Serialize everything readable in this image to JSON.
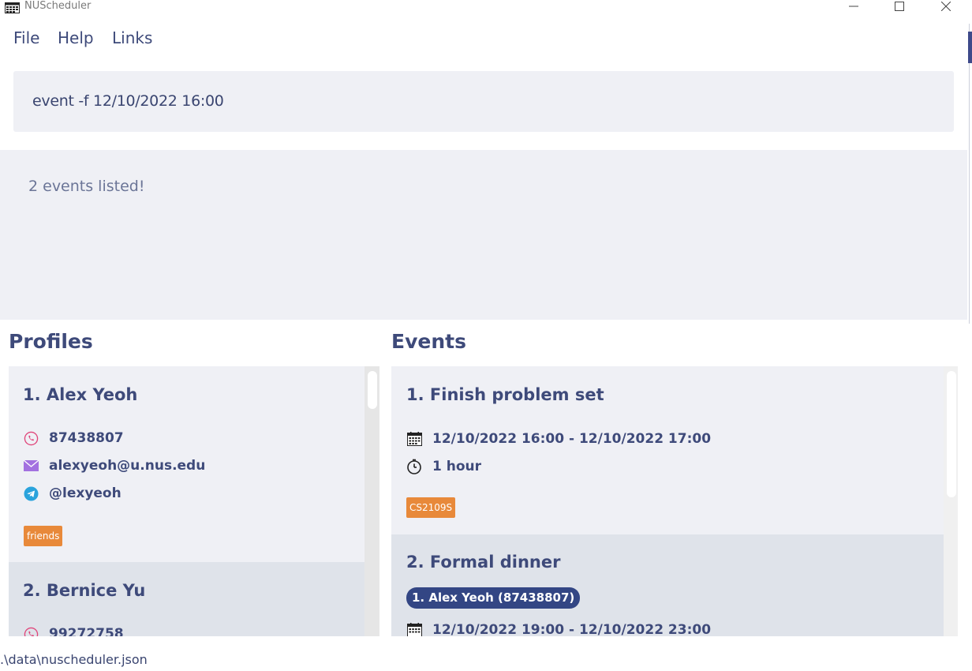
{
  "window": {
    "title": "NUScheduler"
  },
  "menu": {
    "items": [
      "File",
      "Help",
      "Links"
    ]
  },
  "command": {
    "value": "event -f 12/10/2022 16:00"
  },
  "result": {
    "message": "2 events listed!"
  },
  "profiles": {
    "title": "Profiles",
    "items": [
      {
        "index_name": "1.  Alex Yeoh",
        "phone": "87438807",
        "email": "alexyeoh@u.nus.edu",
        "telegram": "@lexyeoh",
        "tag": "friends"
      },
      {
        "index_name": "2.  Bernice Yu",
        "phone": "99272758"
      }
    ]
  },
  "events": {
    "title": "Events",
    "items": [
      {
        "index_title": "1.  Finish problem set",
        "datetime": "12/10/2022 16:00 - 12/10/2022 17:00",
        "duration": "1 hour",
        "tag": "CS2109S"
      },
      {
        "index_title": "2.  Formal dinner",
        "attendee": "1. Alex Yeoh (87438807)",
        "datetime": "12/10/2022 19:00 - 12/10/2022 23:00"
      }
    ]
  },
  "status": {
    "file_path": ".\\data\\nuscheduler.json"
  },
  "colors": {
    "accent": "#3e4a7a",
    "tag": "#e8893a",
    "pill": "#334684",
    "panel": "#eff0f5"
  }
}
